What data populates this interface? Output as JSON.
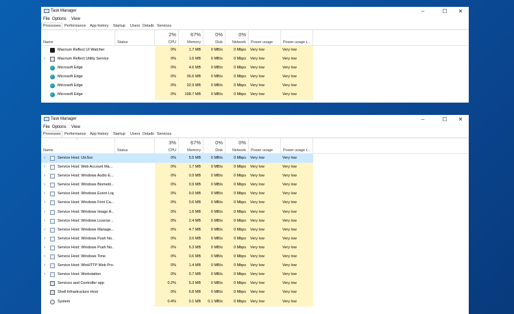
{
  "window1": {
    "title": "Task Manager",
    "menu": [
      "File",
      "Options",
      "View"
    ],
    "tabs": [
      "Processes",
      "Performance",
      "App history",
      "Startup",
      "Users",
      "Details",
      "Services"
    ],
    "header": {
      "name": "Name",
      "status": "Status",
      "cpu_pct": "2%",
      "cpu": "CPU",
      "mem_pct": "67%",
      "mem": "Memory",
      "disk_pct": "0%",
      "disk": "Disk",
      "net_pct": "0%",
      "net": "Network",
      "power": "Power usage",
      "power_trend": "Power usage t..."
    },
    "rows": [
      {
        "icon": "macrium-icon",
        "expand": false,
        "name": "Macrium Reflect UI Watcher",
        "cpu": "0%",
        "mem": "1.7 MB",
        "disk": "0 MB/s",
        "net": "0 Mbps",
        "power": "Very low",
        "trend": "Very low"
      },
      {
        "icon": "box-icon",
        "expand": true,
        "name": "Macrium Reflect Utility Service",
        "cpu": "0%",
        "mem": "1.6 MB",
        "disk": "0 MB/s",
        "net": "0 Mbps",
        "power": "Very low",
        "trend": "Very low"
      },
      {
        "icon": "edge-icon",
        "expand": false,
        "name": "Microsoft Edge",
        "cpu": "0%",
        "mem": "4.6 MB",
        "disk": "0 MB/s",
        "net": "0 Mbps",
        "power": "Very low",
        "trend": "Very low"
      },
      {
        "icon": "edge-icon",
        "expand": false,
        "name": "Microsoft Edge",
        "cpu": "0%",
        "mem": "36.6 MB",
        "disk": "0 MB/s",
        "net": "0 Mbps",
        "power": "Very low",
        "trend": "Very low"
      },
      {
        "icon": "edge-icon",
        "expand": false,
        "name": "Microsoft Edge",
        "cpu": "0%",
        "mem": "32.9 MB",
        "disk": "0 MB/s",
        "net": "0 Mbps",
        "power": "Very low",
        "trend": "Very low"
      },
      {
        "icon": "edge-icon",
        "expand": false,
        "name": "Microsoft Edge",
        "cpu": "0%",
        "mem": "198.7 MB",
        "disk": "0 MB/s",
        "net": "0 Mbps",
        "power": "Very low",
        "trend": "Very low"
      }
    ]
  },
  "window2": {
    "title": "Task Manager",
    "menu": [
      "File",
      "Options",
      "View"
    ],
    "tabs": [
      "Processes",
      "Performance",
      "App history",
      "Startup",
      "Users",
      "Details",
      "Services"
    ],
    "header": {
      "name": "Name",
      "status": "Status",
      "cpu_pct": "3%",
      "cpu": "CPU",
      "mem_pct": "67%",
      "mem": "Memory",
      "disk_pct": "0%",
      "disk": "Disk",
      "net_pct": "0%",
      "net": "Network",
      "power": "Power usage",
      "power_trend": "Power usage t..."
    },
    "rows": [
      {
        "icon": "svc-icon",
        "expand": true,
        "selected": true,
        "name": "Service Host: UtcSvc",
        "cpu": "0%",
        "mem": "5.5 MB",
        "disk": "0 MB/s",
        "net": "0 Mbps",
        "power": "Very low",
        "trend": "Very low"
      },
      {
        "icon": "svc-icon",
        "expand": true,
        "name": "Service Host: Web Account Ma...",
        "cpu": "0%",
        "mem": "1.7 MB",
        "disk": "0 MB/s",
        "net": "0 Mbps",
        "power": "Very low",
        "trend": "Very low"
      },
      {
        "icon": "svc-icon",
        "expand": true,
        "name": "Service Host: Windows Audio E...",
        "cpu": "0%",
        "mem": "0.9 MB",
        "disk": "0 MB/s",
        "net": "0 Mbps",
        "power": "Very low",
        "trend": "Very low"
      },
      {
        "icon": "svc-icon",
        "expand": true,
        "name": "Service Host: Windows Biometri...",
        "cpu": "0%",
        "mem": "0.9 MB",
        "disk": "0 MB/s",
        "net": "0 Mbps",
        "power": "Very low",
        "trend": "Very low"
      },
      {
        "icon": "svc-icon",
        "expand": true,
        "name": "Service Host: Windows Event Log",
        "cpu": "0%",
        "mem": "9.0 MB",
        "disk": "0 MB/s",
        "net": "0 Mbps",
        "power": "Very low",
        "trend": "Very low"
      },
      {
        "icon": "svc-icon",
        "expand": true,
        "name": "Service Host: Windows Font Ca...",
        "cpu": "0%",
        "mem": "0.6 MB",
        "disk": "0 MB/s",
        "net": "0 Mbps",
        "power": "Very low",
        "trend": "Very low"
      },
      {
        "icon": "svc-icon",
        "expand": true,
        "name": "Service Host: Windows Image A...",
        "cpu": "0%",
        "mem": "1.6 MB",
        "disk": "0 MB/s",
        "net": "0 Mbps",
        "power": "Very low",
        "trend": "Very low"
      },
      {
        "icon": "svc-icon",
        "expand": true,
        "name": "Service Host: Windows License ...",
        "cpu": "0%",
        "mem": "2.4 MB",
        "disk": "0 MB/s",
        "net": "0 Mbps",
        "power": "Very low",
        "trend": "Very low"
      },
      {
        "icon": "svc-icon",
        "expand": true,
        "name": "Service Host: Windows Manage...",
        "cpu": "0%",
        "mem": "4.7 MB",
        "disk": "0 MB/s",
        "net": "0 Mbps",
        "power": "Very low",
        "trend": "Very low"
      },
      {
        "icon": "svc-icon",
        "expand": true,
        "name": "Service Host: Windows Push No...",
        "cpu": "0%",
        "mem": "3.0 MB",
        "disk": "0 MB/s",
        "net": "0 Mbps",
        "power": "Very low",
        "trend": "Very low"
      },
      {
        "icon": "svc-icon",
        "expand": true,
        "name": "Service Host: Windows Push No...",
        "cpu": "0%",
        "mem": "5.3 MB",
        "disk": "0 MB/s",
        "net": "0 Mbps",
        "power": "Very low",
        "trend": "Very low"
      },
      {
        "icon": "svc-icon",
        "expand": true,
        "name": "Service Host: Windows Time",
        "cpu": "0%",
        "mem": "0.6 MB",
        "disk": "0 MB/s",
        "net": "0 Mbps",
        "power": "Very low",
        "trend": "Very low"
      },
      {
        "icon": "svc-icon",
        "expand": true,
        "name": "Service Host: WinHTTP Web Pro...",
        "cpu": "0%",
        "mem": "1.4 MB",
        "disk": "0 MB/s",
        "net": "0 Mbps",
        "power": "Very low",
        "trend": "Very low"
      },
      {
        "icon": "svc-icon",
        "expand": true,
        "name": "Service Host: Workstation",
        "cpu": "0%",
        "mem": "0.7 MB",
        "disk": "0 MB/s",
        "net": "0 Mbps",
        "power": "Very low",
        "trend": "Very low"
      },
      {
        "icon": "box-icon",
        "expand": false,
        "name": "Services and Controller app",
        "cpu": "0.2%",
        "mem": "5.3 MB",
        "disk": "0 MB/s",
        "net": "0 Mbps",
        "power": "Very low",
        "trend": "Very low"
      },
      {
        "icon": "box-icon",
        "expand": false,
        "name": "Shell Infrastructure Host",
        "cpu": "0%",
        "mem": "6.8 MB",
        "disk": "0 MB/s",
        "net": "0 Mbps",
        "power": "Very low",
        "trend": "Very low"
      },
      {
        "icon": "gear-icon",
        "expand": false,
        "name": "System",
        "cpu": "0.4%",
        "mem": "0.1 MB",
        "disk": "0.1 MB/s",
        "net": "0 Mbps",
        "power": "Very low",
        "trend": "Very low"
      }
    ]
  }
}
